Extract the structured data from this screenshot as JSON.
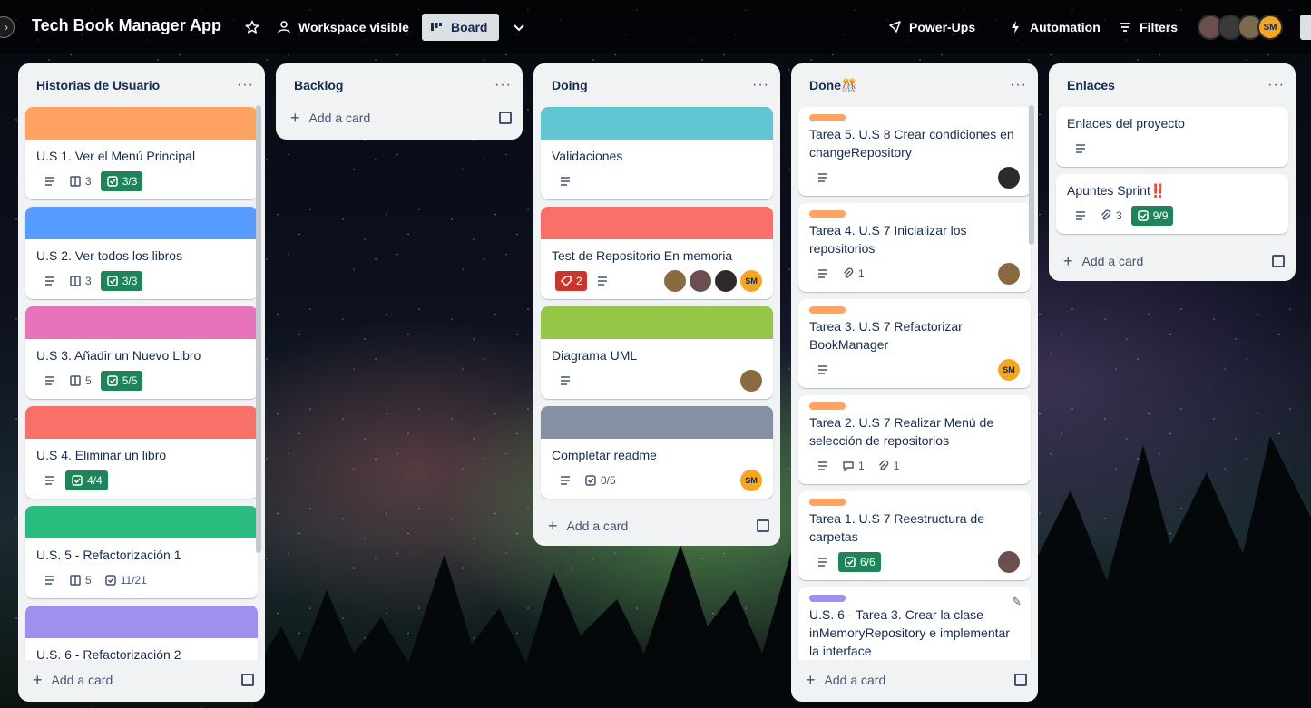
{
  "header": {
    "board_title": "Tech Book Manager App",
    "visibility": "Workspace visible",
    "view": "Board",
    "powerups": "Power-Ups",
    "automation": "Automation",
    "filters": "Filters",
    "members": [
      "",
      "",
      "",
      "SM"
    ]
  },
  "lists": {
    "historias": {
      "title": "Historias de Usuario",
      "add_label": "Add a card",
      "cards": [
        {
          "title": "U.S 1. Ver el Menú Principal",
          "cover": "#fea362",
          "attachments": "3",
          "checklist": "3/3"
        },
        {
          "title": "U.S 2. Ver todos los libros",
          "cover": "#579dff",
          "attachments": "3",
          "checklist": "3/3"
        },
        {
          "title": "U.S 3. Añadir un Nuevo Libro",
          "cover": "#e774bb",
          "attachments": "5",
          "checklist": "5/5"
        },
        {
          "title": "U.S 4. Eliminar un libro",
          "cover": "#f87168",
          "checklist": "4/4"
        },
        {
          "title": "U.S. 5 - Refactorización 1",
          "cover": "#2abb7f",
          "attachments": "5",
          "checklist": "11/21"
        },
        {
          "title": "U.S. 6 - Refactorización 2",
          "cover": "#9f8fef"
        }
      ]
    },
    "backlog": {
      "title": "Backlog",
      "add_label": "Add a card"
    },
    "doing": {
      "title": "Doing",
      "add_label": "Add a card",
      "cards": [
        {
          "title": "Validaciones",
          "cover": "#60c6d2"
        },
        {
          "title": "Test de Repositorio En memoria",
          "cover": "#f87168",
          "due": "2",
          "members": [
            "",
            "",
            "",
            "SM"
          ]
        },
        {
          "title": "Diagrama UML",
          "cover": "#94c748",
          "members": [
            ""
          ]
        },
        {
          "title": "Completar readme",
          "cover": "#8590a2",
          "checklist": "0/5",
          "members": [
            "SM"
          ]
        }
      ]
    },
    "done": {
      "title": "Done🎊",
      "add_label": "Add a card",
      "cards": [
        {
          "title": "Tarea 5. U.S 8 Crear condiciones en changeRepository",
          "label": "#fea362"
        },
        {
          "title": "Tarea 4. U.S 7 Inicializar los repositorios",
          "label": "#fea362",
          "attachments": "1"
        },
        {
          "title": "Tarea 3. U.S 7 Refactorizar BookManager",
          "label": "#fea362",
          "members": [
            "SM"
          ]
        },
        {
          "title": "Tarea 2. U.S 7 Realizar Menú de selección de repositorios",
          "label": "#fea362",
          "comments": "1",
          "attachments": "1"
        },
        {
          "title": "Tarea 1. U.S 7 Reestructura de carpetas",
          "label": "#fea362",
          "checklist": "6/6"
        },
        {
          "title": "U.S. 6 - Tarea 3. Crear la clase inMemoryRepository e implementar la interface",
          "label": "#9f8fef"
        }
      ]
    },
    "enlaces": {
      "title": "Enlaces",
      "add_label": "Add a card",
      "cards": [
        {
          "title": "Enlaces del proyecto"
        },
        {
          "title": "Apuntes Sprint‼️",
          "attachments": "3",
          "checklist": "9/9"
        }
      ]
    }
  },
  "colors": {
    "accent": "#1f845a",
    "sm_avatar": "#f5a623",
    "list_bg": "#f1f2f4"
  }
}
